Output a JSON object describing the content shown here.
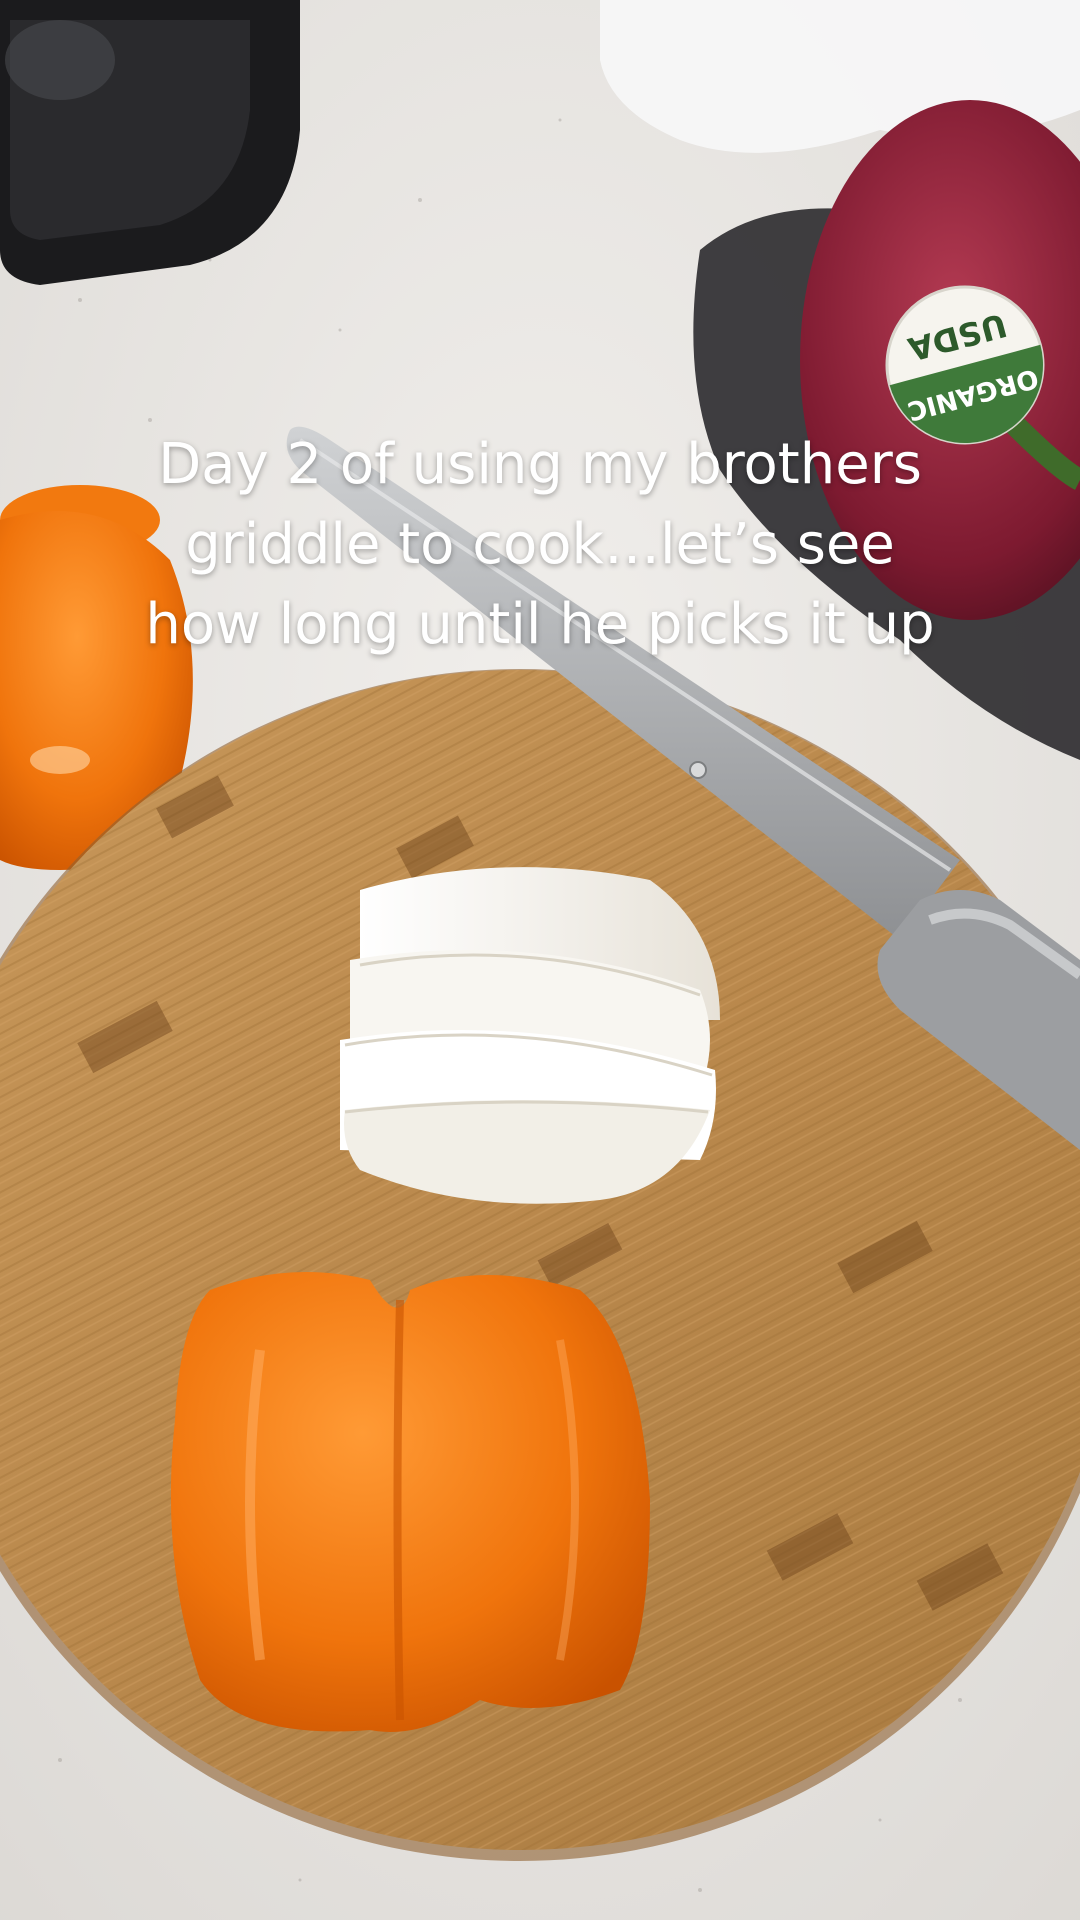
{
  "caption": {
    "lines": [
      "Day 2 of using my brothers",
      "griddle to cook…let’s see",
      "how long until he picks it up"
    ]
  },
  "sticker": {
    "line1": "USDA",
    "line2": "ORGANIC"
  },
  "colors": {
    "countertop": "#e9e7e4",
    "board": "#b98849",
    "onion": "#f4f1ea",
    "orange_pepper": "#f0780f",
    "red_onion": "#8a1f35",
    "knife_blade": "#a9abad"
  }
}
